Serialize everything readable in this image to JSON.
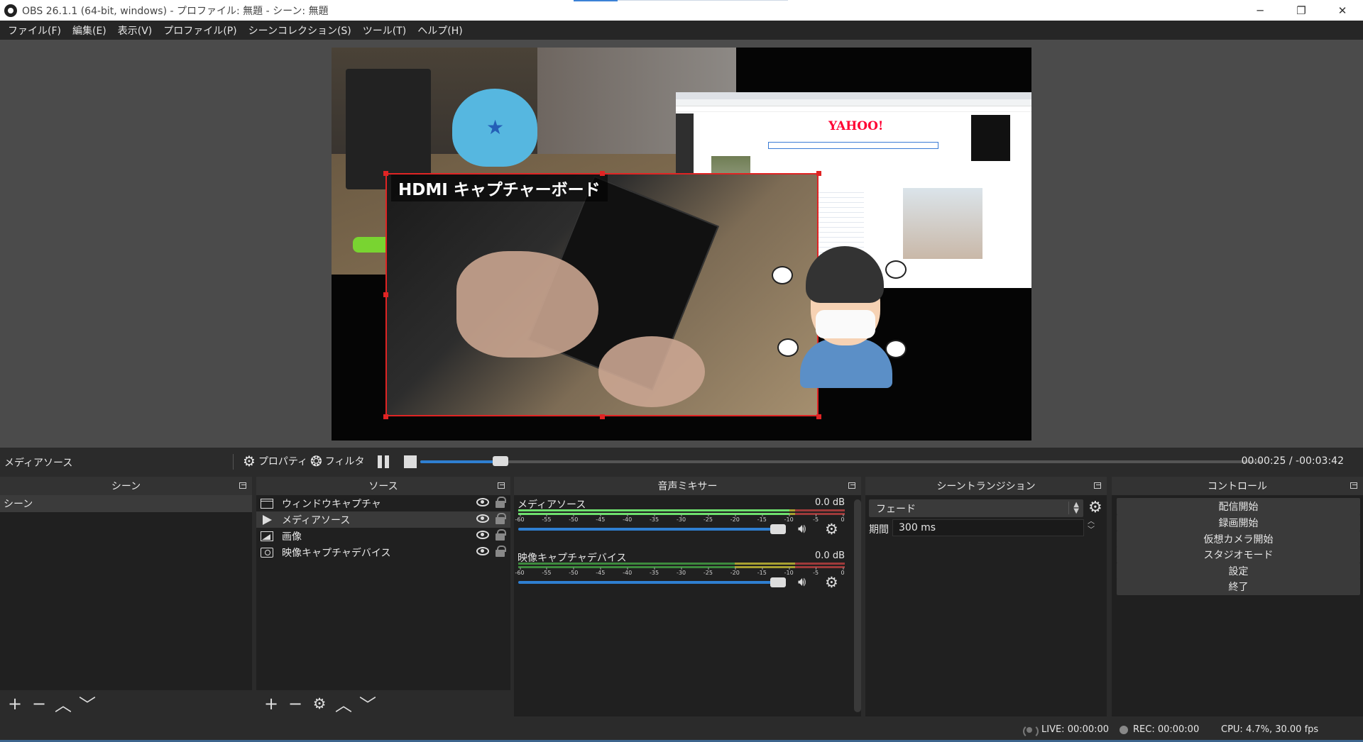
{
  "window": {
    "title": "OBS 26.1.1 (64-bit, windows) - プロファイル: 無題 - シーン: 無題",
    "minimize": "─",
    "maximize": "❐",
    "close": "✕"
  },
  "menu": [
    "ファイル(F)",
    "編集(E)",
    "表示(V)",
    "プロファイル(P)",
    "シーンコレクション(S)",
    "ツール(T)",
    "ヘルプ(H)"
  ],
  "preview": {
    "caption": "HDMI キャプチャーボード",
    "browser_logo": "YAHOO!",
    "accent_color": "#e02424"
  },
  "media_controls": {
    "source_name": "メディアソース",
    "properties_label": "プロパティ",
    "filters_label": "フィルタ",
    "progress": 0.095,
    "time": "00:00:25 / -00:03:42"
  },
  "docks": {
    "scenes": {
      "title": "シーン",
      "items": [
        "シーン"
      ]
    },
    "sources": {
      "title": "ソース",
      "items": [
        {
          "icon": "window-icon",
          "label": "ウィンドウキャプチャ"
        },
        {
          "icon": "play-icon",
          "label": "メディアソース"
        },
        {
          "icon": "image-icon",
          "label": "画像"
        },
        {
          "icon": "camera-icon",
          "label": "映像キャプチャデバイス"
        }
      ]
    },
    "mixer": {
      "title": "音声ミキサー",
      "channels": [
        {
          "name": "メディアソース",
          "db": "0.0 dB",
          "level": 0.83
        },
        {
          "name": "映像キャプチャデバイス",
          "db": "0.0 dB",
          "level": 0.0
        }
      ],
      "ticks": [
        "-60",
        "-55",
        "-50",
        "-45",
        "-40",
        "-35",
        "-30",
        "-25",
        "-20",
        "-15",
        "-10",
        "-5",
        "0"
      ]
    },
    "transitions": {
      "title": "シーントランジション",
      "selected": "フェード",
      "duration_label": "期間",
      "duration_value": "300 ms"
    },
    "controls": {
      "title": "コントロール",
      "buttons": [
        "配信開始",
        "録画開始",
        "仮想カメラ開始",
        "スタジオモード",
        "設定",
        "終了"
      ]
    }
  },
  "status": {
    "live": "LIVE: 00:00:00",
    "rec": "REC: 00:00:00",
    "cpu": "CPU: 4.7%, 30.00 fps"
  }
}
